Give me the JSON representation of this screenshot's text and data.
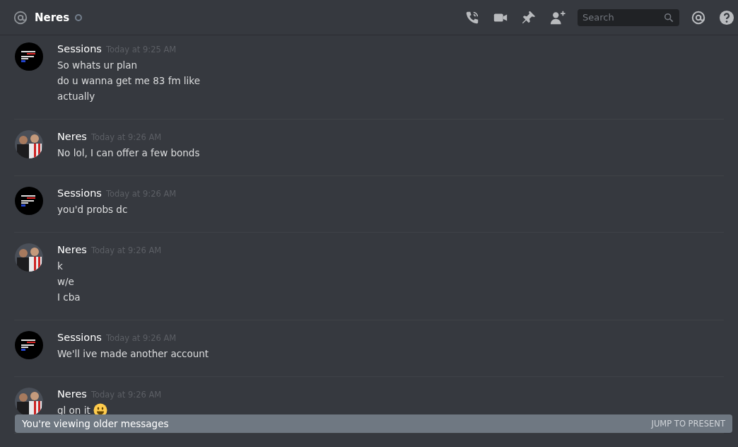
{
  "header": {
    "title": "Neres",
    "online": false,
    "search": {
      "placeholder": "Search"
    }
  },
  "messages": [
    {
      "author": "Sessions",
      "avatar": {
        "kind": "poster"
      },
      "time": "Today at 9:25 AM",
      "lines": [
        {
          "text": "So whats ur plan"
        },
        {
          "text": "do u wanna get me 83 fm like"
        },
        {
          "text": "actually"
        }
      ]
    },
    {
      "author": "Neres",
      "time": "Today at 9:26 AM",
      "lines": [
        {
          "text": "No lol, I can offer a few bonds"
        }
      ]
    },
    {
      "author": "Sessions",
      "avatar": {
        "kind": "poster"
      },
      "time": "Today at 9:26 AM",
      "lines": [
        {
          "text": "you'd probs dc"
        }
      ]
    },
    {
      "author": "Neres",
      "time": "Today at 9:26 AM",
      "lines": [
        {
          "text": "k"
        },
        {
          "text": "w/e"
        },
        {
          "text": "I cba"
        }
      ]
    },
    {
      "author": "Sessions",
      "avatar": {
        "kind": "poster"
      },
      "time": "Today at 9:26 AM",
      "lines": [
        {
          "text": "We'll ive made another account"
        }
      ]
    },
    {
      "author": "Neres",
      "time": "Today at 9:26 AM",
      "lines": [
        {
          "text": "gl on it",
          "emoji": true
        }
      ]
    }
  ],
  "banner": {
    "text": "You're viewing older messages",
    "action": "JUMP TO PRESENT"
  }
}
